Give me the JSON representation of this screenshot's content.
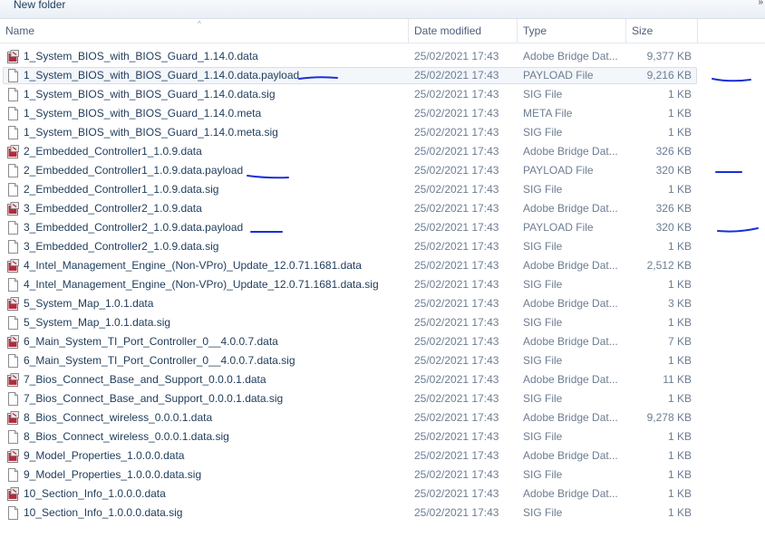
{
  "toolbar": {
    "new_folder_label": "New folder",
    "overflow_label": "»"
  },
  "columns": {
    "name": "Name",
    "date": "Date modified",
    "type": "Type",
    "size": "Size",
    "sort_arrow": "^"
  },
  "colors": {
    "scribble": "#1a2fd6",
    "adobe_icon": "#b52a3c"
  },
  "files": [
    {
      "name": "1_System_BIOS_with_BIOS_Guard_1.14.0.data",
      "date": "25/02/2021 17:43",
      "type": "Adobe Bridge Dat...",
      "size": "9,377 KB",
      "icon": "adobe-bridge-file-icon"
    },
    {
      "name": "1_System_BIOS_with_BIOS_Guard_1.14.0.data.payload",
      "date": "25/02/2021 17:43",
      "type": "PAYLOAD File",
      "size": "9,216 KB",
      "icon": "generic-file-icon",
      "selected": true
    },
    {
      "name": "1_System_BIOS_with_BIOS_Guard_1.14.0.data.sig",
      "date": "25/02/2021 17:43",
      "type": "SIG File",
      "size": "1 KB",
      "icon": "generic-file-icon"
    },
    {
      "name": "1_System_BIOS_with_BIOS_Guard_1.14.0.meta",
      "date": "25/02/2021 17:43",
      "type": "META File",
      "size": "1 KB",
      "icon": "generic-file-icon"
    },
    {
      "name": "1_System_BIOS_with_BIOS_Guard_1.14.0.meta.sig",
      "date": "25/02/2021 17:43",
      "type": "SIG File",
      "size": "1 KB",
      "icon": "generic-file-icon"
    },
    {
      "name": "2_Embedded_Controller1_1.0.9.data",
      "date": "25/02/2021 17:43",
      "type": "Adobe Bridge Dat...",
      "size": "326 KB",
      "icon": "adobe-bridge-file-icon"
    },
    {
      "name": "2_Embedded_Controller1_1.0.9.data.payload",
      "date": "25/02/2021 17:43",
      "type": "PAYLOAD File",
      "size": "320 KB",
      "icon": "generic-file-icon"
    },
    {
      "name": "2_Embedded_Controller1_1.0.9.data.sig",
      "date": "25/02/2021 17:43",
      "type": "SIG File",
      "size": "1 KB",
      "icon": "generic-file-icon"
    },
    {
      "name": "3_Embedded_Controller2_1.0.9.data",
      "date": "25/02/2021 17:43",
      "type": "Adobe Bridge Dat...",
      "size": "326 KB",
      "icon": "adobe-bridge-file-icon"
    },
    {
      "name": "3_Embedded_Controller2_1.0.9.data.payload",
      "date": "25/02/2021 17:43",
      "type": "PAYLOAD File",
      "size": "320 KB",
      "icon": "generic-file-icon"
    },
    {
      "name": "3_Embedded_Controller2_1.0.9.data.sig",
      "date": "25/02/2021 17:43",
      "type": "SIG File",
      "size": "1 KB",
      "icon": "generic-file-icon"
    },
    {
      "name": "4_Intel_Management_Engine_(Non-VPro)_Update_12.0.71.1681.data",
      "date": "25/02/2021 17:43",
      "type": "Adobe Bridge Dat...",
      "size": "2,512 KB",
      "icon": "adobe-bridge-file-icon"
    },
    {
      "name": "4_Intel_Management_Engine_(Non-VPro)_Update_12.0.71.1681.data.sig",
      "date": "25/02/2021 17:43",
      "type": "SIG File",
      "size": "1 KB",
      "icon": "generic-file-icon"
    },
    {
      "name": "5_System_Map_1.0.1.data",
      "date": "25/02/2021 17:43",
      "type": "Adobe Bridge Dat...",
      "size": "3 KB",
      "icon": "adobe-bridge-file-icon"
    },
    {
      "name": "5_System_Map_1.0.1.data.sig",
      "date": "25/02/2021 17:43",
      "type": "SIG File",
      "size": "1 KB",
      "icon": "generic-file-icon"
    },
    {
      "name": "6_Main_System_TI_Port_Controller_0__4.0.0.7.data",
      "date": "25/02/2021 17:43",
      "type": "Adobe Bridge Dat...",
      "size": "7 KB",
      "icon": "adobe-bridge-file-icon"
    },
    {
      "name": "6_Main_System_TI_Port_Controller_0__4.0.0.7.data.sig",
      "date": "25/02/2021 17:43",
      "type": "SIG File",
      "size": "1 KB",
      "icon": "generic-file-icon"
    },
    {
      "name": "7_Bios_Connect_Base_and_Support_0.0.0.1.data",
      "date": "25/02/2021 17:43",
      "type": "Adobe Bridge Dat...",
      "size": "11 KB",
      "icon": "adobe-bridge-file-icon"
    },
    {
      "name": "7_Bios_Connect_Base_and_Support_0.0.0.1.data.sig",
      "date": "25/02/2021 17:43",
      "type": "SIG File",
      "size": "1 KB",
      "icon": "generic-file-icon"
    },
    {
      "name": "8_Bios_Connect_wireless_0.0.0.1.data",
      "date": "25/02/2021 17:43",
      "type": "Adobe Bridge Dat...",
      "size": "9,278 KB",
      "icon": "adobe-bridge-file-icon"
    },
    {
      "name": "8_Bios_Connect_wireless_0.0.0.1.data.sig",
      "date": "25/02/2021 17:43",
      "type": "SIG File",
      "size": "1 KB",
      "icon": "generic-file-icon"
    },
    {
      "name": "9_Model_Properties_1.0.0.0.data",
      "date": "25/02/2021 17:43",
      "type": "Adobe Bridge Dat...",
      "size": "1 KB",
      "icon": "adobe-bridge-file-icon"
    },
    {
      "name": "9_Model_Properties_1.0.0.0.data.sig",
      "date": "25/02/2021 17:43",
      "type": "SIG File",
      "size": "1 KB",
      "icon": "generic-file-icon"
    },
    {
      "name": "10_Section_Info_1.0.0.0.data",
      "date": "25/02/2021 17:43",
      "type": "Adobe Bridge Dat...",
      "size": "1 KB",
      "icon": "adobe-bridge-file-icon"
    },
    {
      "name": "10_Section_Info_1.0.0.0.data.sig",
      "date": "25/02/2021 17:43",
      "type": "SIG File",
      "size": "1 KB",
      "icon": "generic-file-icon"
    }
  ]
}
